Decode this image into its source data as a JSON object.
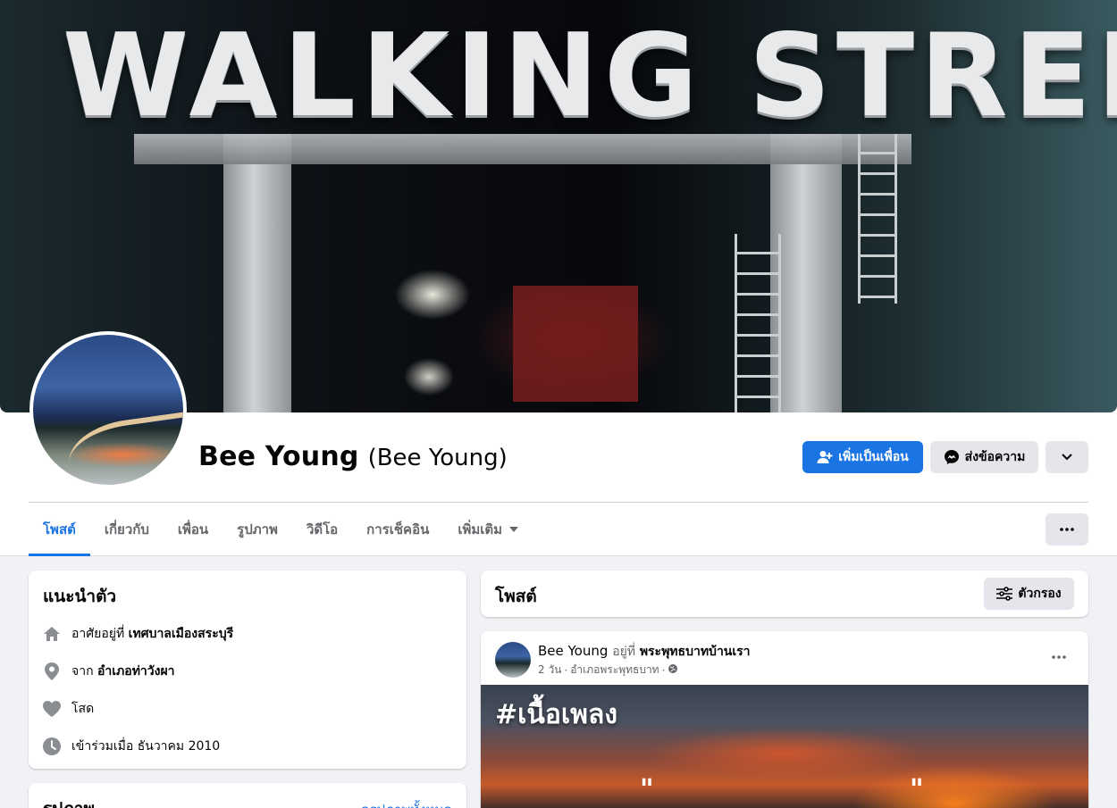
{
  "cover": {
    "sign_text": "WALKING STREET"
  },
  "profile": {
    "name": "Bee Young",
    "alt_name": "(Bee Young)"
  },
  "actions": {
    "add_friend": "เพิ่มเป็นเพื่อน",
    "message": "ส่งข้อความ"
  },
  "tabs": [
    {
      "label": "โพสต์"
    },
    {
      "label": "เกี่ยวกับ"
    },
    {
      "label": "เพื่อน"
    },
    {
      "label": "รูปภาพ"
    },
    {
      "label": "วิดีโอ"
    },
    {
      "label": "การเช็คอิน"
    },
    {
      "label": "เพิ่มเติม"
    }
  ],
  "intro": {
    "title": "แนะนำตัว",
    "items": [
      {
        "icon": "home-icon",
        "prefix": "อาศัยอยู่ที่",
        "value": "เทศบาลเมืองสระบุรี"
      },
      {
        "icon": "location-pin-icon",
        "prefix": "จาก",
        "value": "อำเภอท่าวังผา"
      },
      {
        "icon": "heart-icon",
        "prefix": "โสด",
        "value": ""
      },
      {
        "icon": "clock-icon",
        "prefix": "เข้าร่วมเมื่อ ธันวาคม 2010",
        "value": ""
      }
    ]
  },
  "photos": {
    "title": "รูปภาพ",
    "see_all": "ดูรูปภาพทั้งหมด"
  },
  "posts_header": {
    "title": "โพสต์",
    "filter": "ตัวกรอง"
  },
  "post": {
    "author": "Bee Young",
    "at_text": "อยู่ที่",
    "place": "พระพุทธบาทบ้านเรา",
    "time": "2 วัน",
    "location": "อำเภอพระพุทธบาท",
    "image_tag": "#เนื้อเพลง"
  },
  "colors": {
    "accent": "#1b74e4",
    "secondary_text": "#65676b"
  }
}
